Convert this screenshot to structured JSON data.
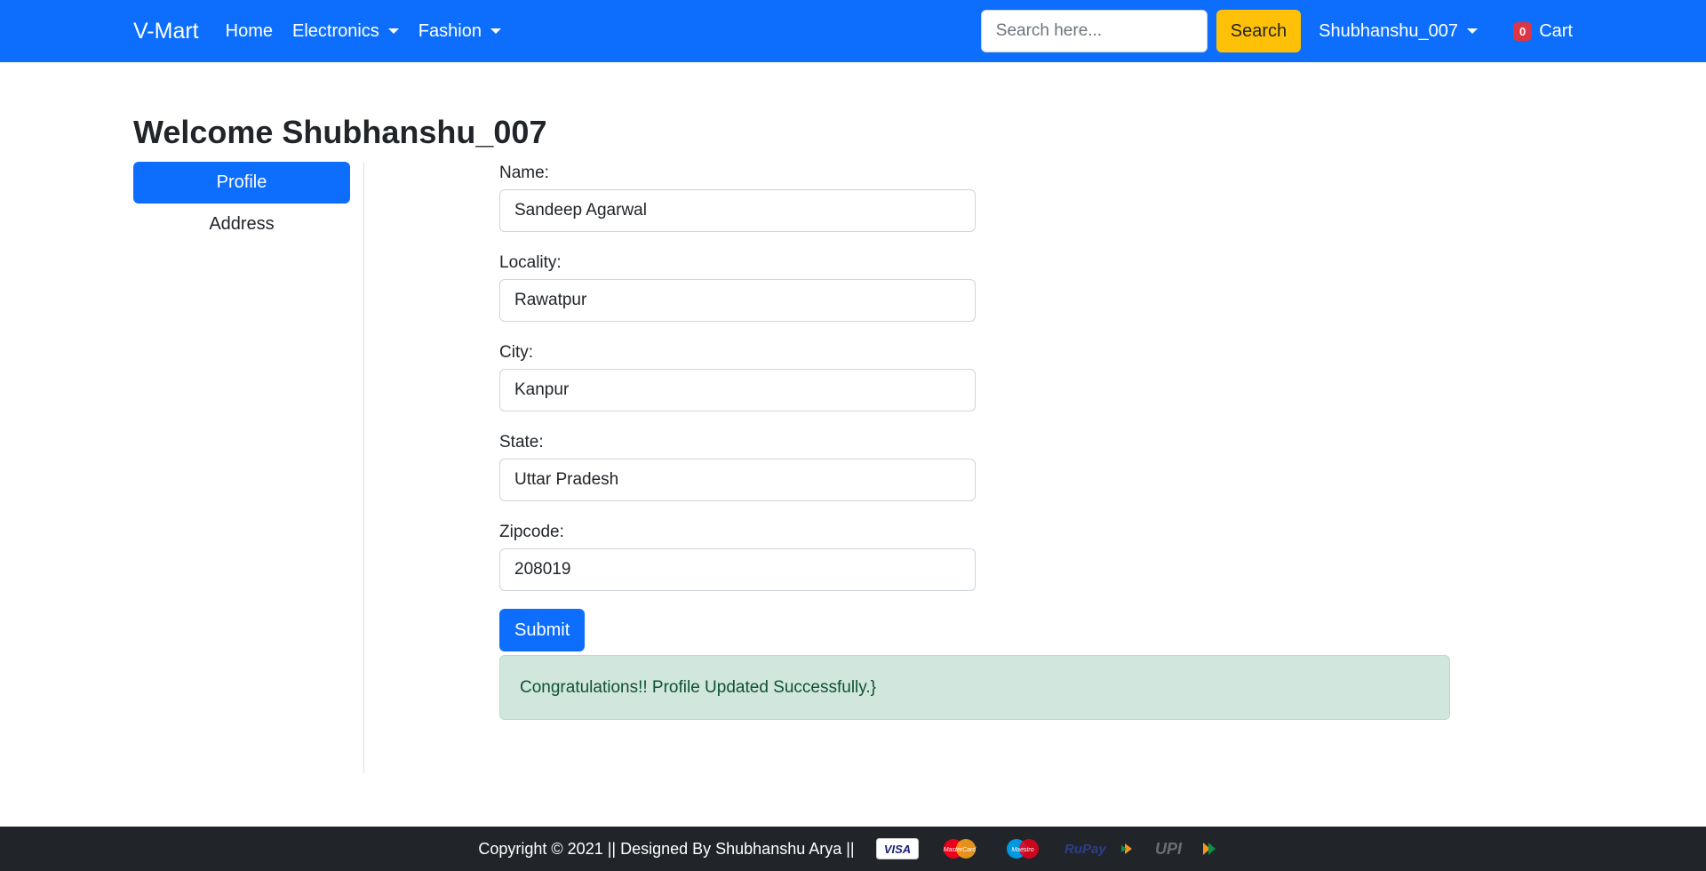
{
  "navbar": {
    "brand": "V-Mart",
    "links": [
      "Home",
      "Electronics",
      "Fashion"
    ],
    "search_placeholder": "Search here...",
    "search_button": "Search",
    "user": "Shubhanshu_007",
    "cart_count": "0",
    "cart_label": "Cart"
  },
  "welcome": "Welcome Shubhanshu_007",
  "sidebar": {
    "items": [
      {
        "label": "Profile",
        "active": true
      },
      {
        "label": "Address",
        "active": false
      }
    ]
  },
  "form": {
    "fields": [
      {
        "label": "Name:",
        "value": "Sandeep Agarwal"
      },
      {
        "label": "Locality:",
        "value": "Rawatpur"
      },
      {
        "label": "City:",
        "value": "Kanpur"
      },
      {
        "label": "State:",
        "value": "Uttar Pradesh"
      },
      {
        "label": "Zipcode:",
        "value": "208019"
      }
    ],
    "submit": "Submit"
  },
  "alert": "Congratulations!! Profile Updated Successfully.}",
  "footer": {
    "text": "Copyright © 2021 || Designed By Shubhanshu Arya ||",
    "payment_icons": [
      "visa-icon",
      "mastercard-icon",
      "maestro-icon",
      "rupay-icon",
      "upi-icon"
    ],
    "visa": "VISA",
    "mastercard": "MasterCard",
    "maestro": "Maestro",
    "rupay": "RuPay",
    "upi": "UPI"
  },
  "colors": {
    "primary": "#0d6efd",
    "warning": "#ffc107",
    "danger": "#dc3545",
    "success_bg": "#d1e7dd",
    "footer_bg": "#212529"
  }
}
